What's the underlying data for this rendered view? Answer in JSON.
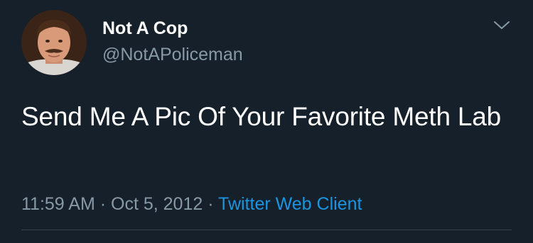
{
  "user": {
    "display_name": "Not A Cop",
    "handle": "@NotAPoliceman",
    "avatar_icon": "user-avatar-photo"
  },
  "tweet": {
    "text": "Send Me A Pic Of Your Favorite Meth Lab",
    "time": "11:59 AM",
    "separator": "·",
    "date": "Oct 5, 2012",
    "client": "Twitter Web Client"
  },
  "menu": {
    "icon": "chevron-down-icon"
  },
  "colors": {
    "background": "#15202b",
    "primary_text": "#ffffff",
    "secondary_text": "#8899a6",
    "link": "#1b95e0",
    "divider": "#38444d"
  }
}
